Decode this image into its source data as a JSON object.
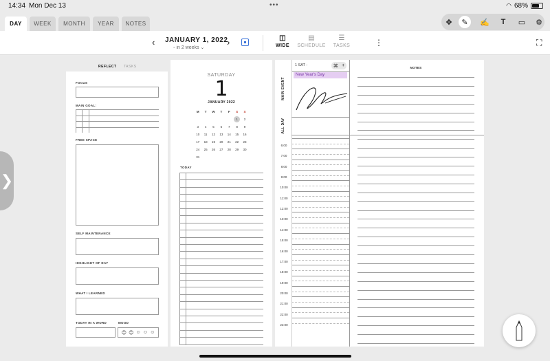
{
  "status": {
    "time": "14:34",
    "date": "Mon Dec 13",
    "battery": "68%",
    "battery_level": 0.68
  },
  "tabs": [
    "DAY",
    "WEEK",
    "MONTH",
    "YEAR",
    "NOTES"
  ],
  "active_tab": "DAY",
  "tools": [
    "move-icon",
    "pen-icon",
    "edit-note-icon",
    "text-box-icon",
    "add-calendar-icon",
    "settings-icon"
  ],
  "nav": {
    "title": "JANUARY 1, 2022",
    "subtitle": "in 2 weeks",
    "modes": [
      "WIDE",
      "SCHEDULE",
      "TASKS"
    ],
    "active_mode": "WIDE"
  },
  "reflect": {
    "tabs": [
      "REFLECT",
      "TASKS"
    ],
    "labels": {
      "focus": "FOCUS",
      "main_goal": "MAIN GOAL:",
      "free_space": "FREE SPACE",
      "self_maintenance": "SELF MAINTENANCE",
      "highlight": "HIGHLIGHT OF DAY",
      "learned": "WHAT I LEARNED",
      "today_word": "TODAY IN A WORD",
      "mood": "MOOD"
    },
    "mood_faces": [
      "☹",
      "☹",
      "☺",
      "☺",
      "☺"
    ]
  },
  "day": {
    "weekday": "SATURDAY",
    "number": "1",
    "month_title": "JANUARY 2022",
    "weekday_headers": [
      "M",
      "T",
      "W",
      "T",
      "F",
      "S",
      "S"
    ],
    "weeks": [
      [
        "",
        "",
        "",
        "",
        "",
        "1",
        "2"
      ],
      [
        "3",
        "4",
        "5",
        "6",
        "7",
        "8",
        "9"
      ],
      [
        "10",
        "11",
        "12",
        "13",
        "14",
        "15",
        "16"
      ],
      [
        "17",
        "18",
        "19",
        "20",
        "21",
        "22",
        "23"
      ],
      [
        "24",
        "25",
        "26",
        "27",
        "28",
        "29",
        "30"
      ],
      [
        "31",
        "",
        "",
        "",
        "",
        "",
        ""
      ]
    ],
    "today_label": "TODAY"
  },
  "schedule": {
    "date_chip": "1 SAT",
    "chevron": "›",
    "main_event_label": "MAIN EVENT",
    "all_day_label": "ALL DAY",
    "event": "New Year's Day",
    "hours": [
      "6:00",
      "7:00",
      "8:00",
      "9:00",
      "10:00",
      "11:00",
      "12:00",
      "13:00",
      "14:00",
      "15:00",
      "16:00",
      "17:00",
      "18:00",
      "19:00",
      "20:00",
      "21:00",
      "22:00",
      "23:00"
    ]
  },
  "notes": {
    "title": "NOTES"
  },
  "colors": {
    "accent": "#3b73d9",
    "event_bg": "#e5cdf2",
    "event_text": "#7a3aa8",
    "weekend": "#c0392b"
  }
}
